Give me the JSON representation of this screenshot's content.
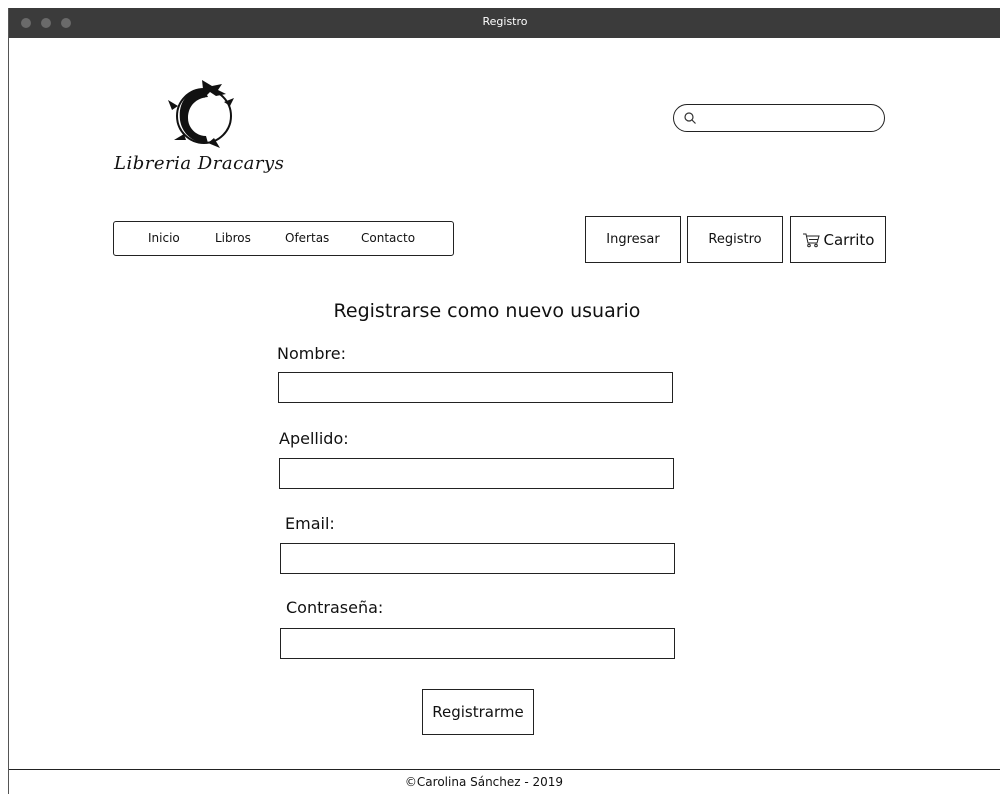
{
  "window": {
    "title": "Registro"
  },
  "brand": {
    "name": "Libreria Dracarys"
  },
  "search": {
    "value": "",
    "placeholder": ""
  },
  "nav": {
    "items": [
      "Inicio",
      "Libros",
      "Ofertas",
      "Contacto"
    ]
  },
  "account": {
    "login_label": "Ingresar",
    "register_label": "Registro",
    "cart_label": "Carrito"
  },
  "form": {
    "title": "Registrarse como nuevo usuario",
    "fields": [
      {
        "label": "Nombre:",
        "value": ""
      },
      {
        "label": "Apellido:",
        "value": ""
      },
      {
        "label": "Email:",
        "value": ""
      },
      {
        "label": "Contraseña:",
        "value": ""
      }
    ],
    "submit_label": "Registrarme"
  },
  "footer": {
    "text": "Carolina Sánchez - 2019",
    "copyright_symbol": "©"
  },
  "icons": [
    "dragon-logo-icon",
    "search-icon",
    "cart-icon"
  ],
  "colors": {
    "titlebar": "#3b3b3b",
    "border": "#222222",
    "background": "#ffffff"
  }
}
